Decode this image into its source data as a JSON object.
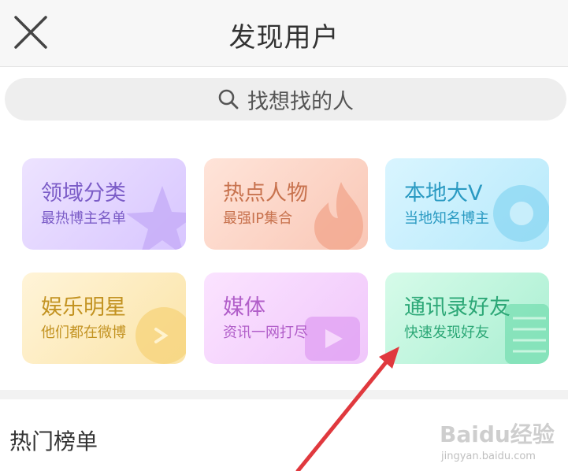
{
  "header": {
    "title": "发现用户",
    "close_icon": "close-icon"
  },
  "search": {
    "placeholder": "找想找的人",
    "icon": "search-icon"
  },
  "cards": [
    {
      "title": "领域分类",
      "subtitle": "最热博主名单",
      "icon": "star-icon",
      "color": "#7b5cc7"
    },
    {
      "title": "热点人物",
      "subtitle": "最强IP集合",
      "icon": "flame-icon",
      "color": "#c8734f"
    },
    {
      "title": "本地大V",
      "subtitle": "当地知名博主",
      "icon": "location-pin-icon",
      "color": "#2a9ac2"
    },
    {
      "title": "娱乐明星",
      "subtitle": "他们都在微博",
      "icon": "chat-bubble-icon",
      "color": "#c39322"
    },
    {
      "title": "媒体",
      "subtitle": "资讯一网打尽",
      "icon": "video-camera-icon",
      "color": "#b15ec9"
    },
    {
      "title": "通讯录好友",
      "subtitle": "快速发现好友",
      "icon": "contacts-book-icon",
      "color": "#2da877"
    }
  ],
  "hot_list": {
    "title": "热门榜单"
  },
  "watermark": {
    "text": "Baidu经验",
    "url": "jingyan.baidu.com"
  },
  "annotation": {
    "arrow_color": "#e0393e"
  }
}
